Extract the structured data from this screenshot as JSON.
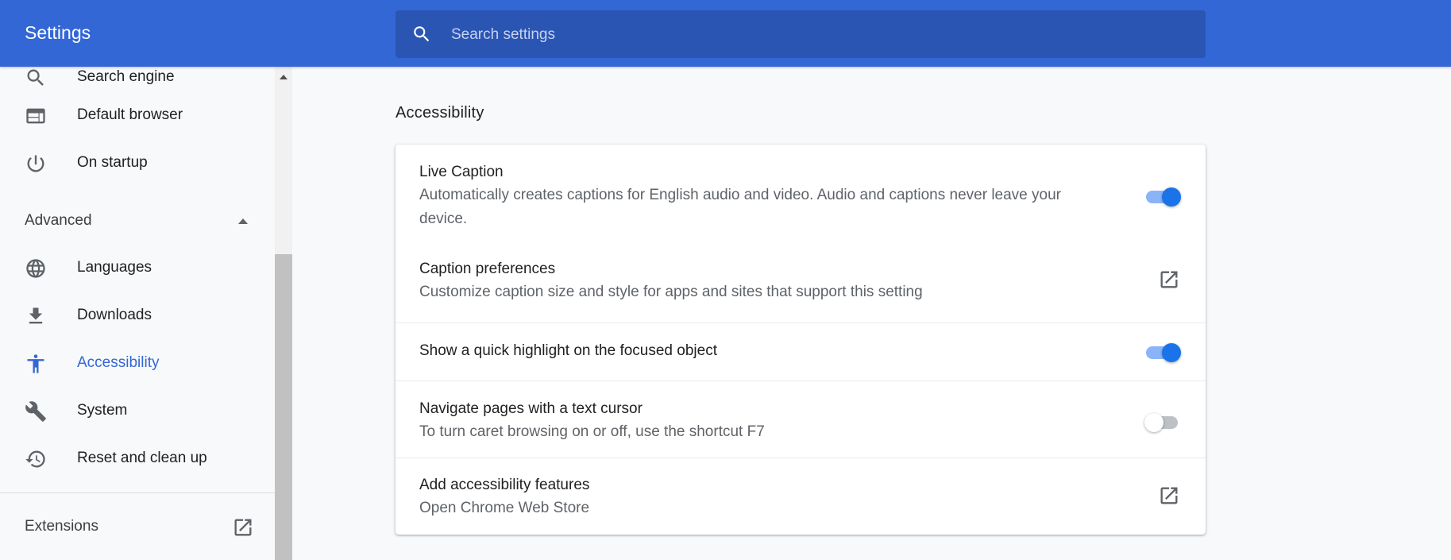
{
  "header": {
    "title": "Settings",
    "search_placeholder": "Search settings"
  },
  "sidebar": {
    "items_top": [
      {
        "label": "Search engine",
        "icon": "search-icon"
      },
      {
        "label": "Default browser",
        "icon": "browser-icon"
      },
      {
        "label": "On startup",
        "icon": "power-icon"
      }
    ],
    "advanced_label": "Advanced",
    "advanced_items": [
      {
        "label": "Languages",
        "icon": "globe-icon"
      },
      {
        "label": "Downloads",
        "icon": "download-icon"
      },
      {
        "label": "Accessibility",
        "icon": "accessibility-icon",
        "active": true
      },
      {
        "label": "System",
        "icon": "wrench-icon"
      },
      {
        "label": "Reset and clean up",
        "icon": "restore-icon"
      }
    ],
    "extensions_label": "Extensions"
  },
  "main": {
    "section_title": "Accessibility",
    "rows": [
      {
        "title": "Live Caption",
        "subtitle": "Automatically creates captions for English audio and video. Audio and captions never leave your device.",
        "control": "toggle",
        "on": true
      },
      {
        "title": "Caption preferences",
        "subtitle": "Customize caption size and style for apps and sites that support this setting",
        "control": "external-link"
      },
      {
        "title": "Show a quick highlight on the focused object",
        "control": "toggle",
        "on": true
      },
      {
        "title": "Navigate pages with a text cursor",
        "subtitle": "To turn caret browsing on or off, use the shortcut F7",
        "control": "toggle",
        "on": false
      },
      {
        "title": "Add accessibility features",
        "subtitle": "Open Chrome Web Store",
        "control": "external-link"
      }
    ]
  },
  "colors": {
    "header_bg": "#3367d6",
    "accent": "#1a73e8",
    "active_nav": "#3367d6"
  }
}
